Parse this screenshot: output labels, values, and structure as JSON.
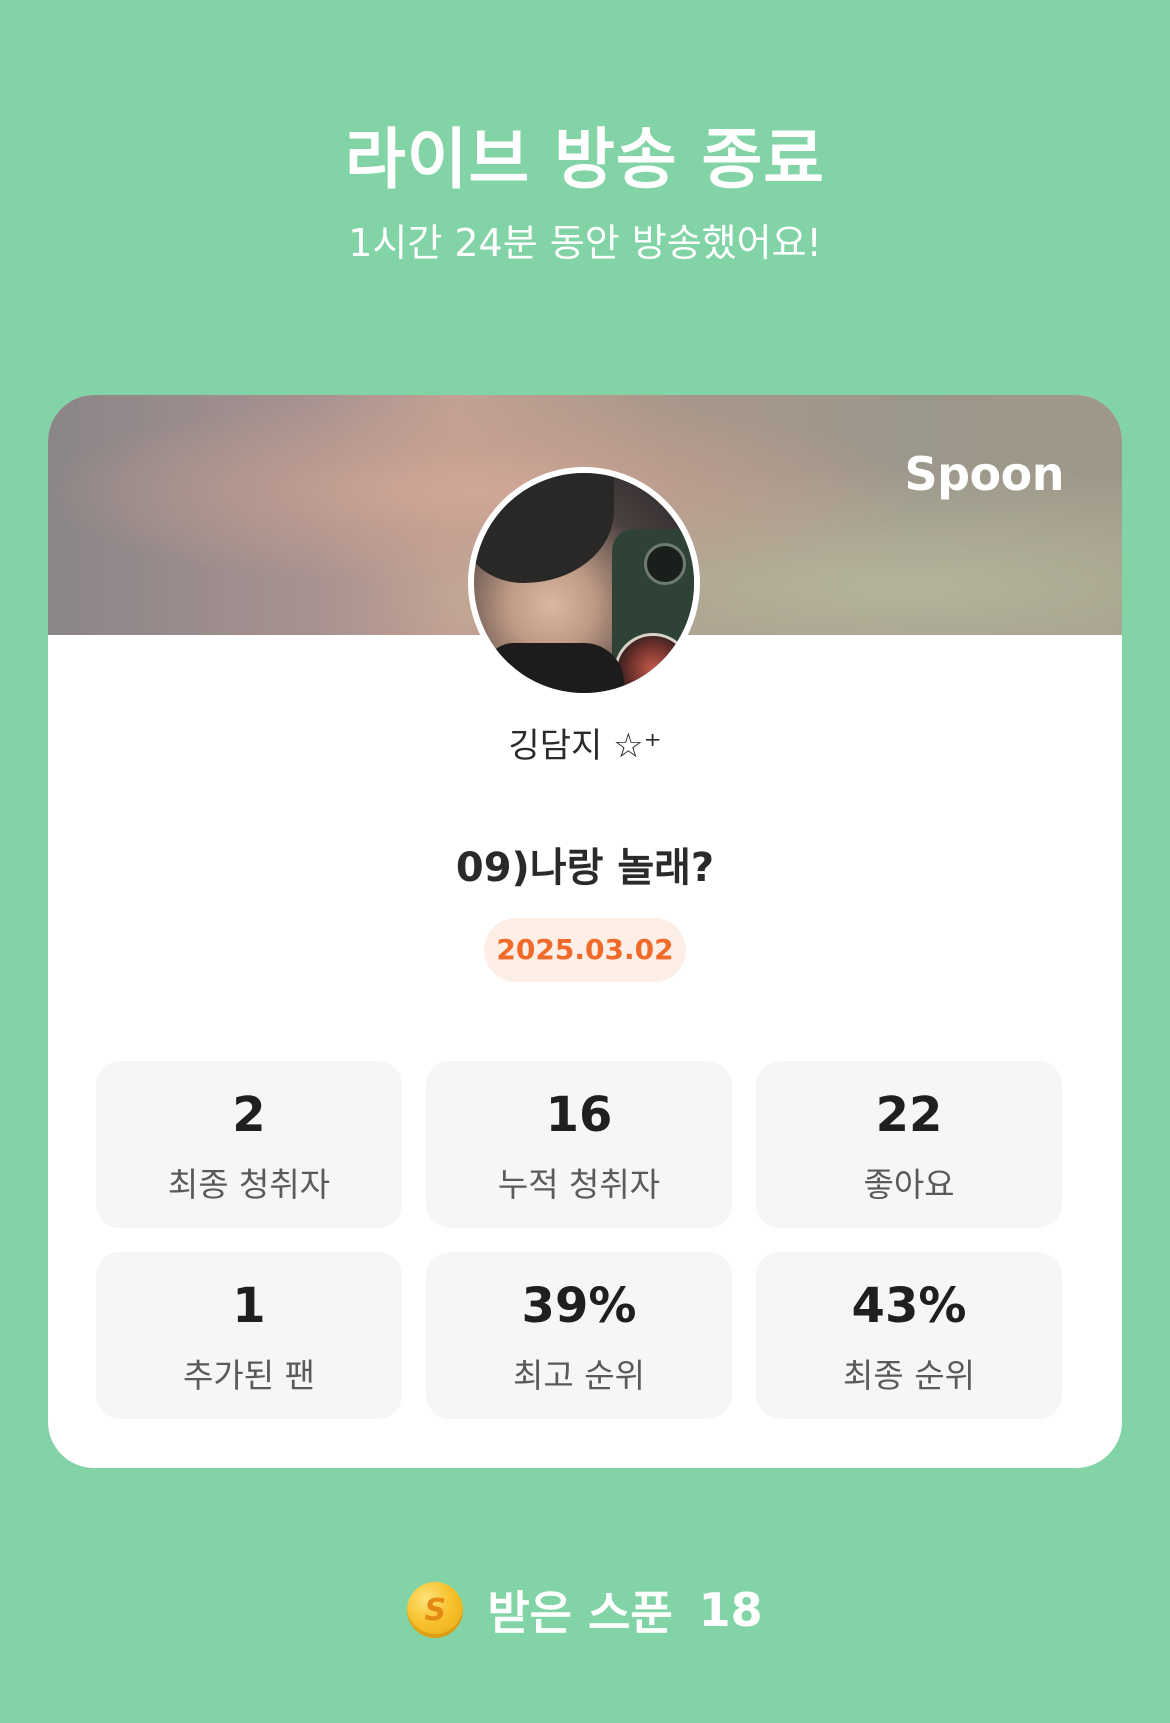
{
  "header": {
    "title": "라이브 방송 종료",
    "subtitle": "1시간 24분 동안 방송했어요!"
  },
  "card": {
    "brand": "Spoon",
    "nickname": "깅담지 ☆⁺",
    "live_title": "09)나랑 놀래?",
    "date": "2025.03.02"
  },
  "stats": [
    {
      "value": "2",
      "label": "최종 청취자"
    },
    {
      "value": "16",
      "label": "누적 청취자"
    },
    {
      "value": "22",
      "label": "좋아요"
    },
    {
      "value": "1",
      "label": "추가된 팬"
    },
    {
      "value": "39%",
      "label": "최고 순위"
    },
    {
      "value": "43%",
      "label": "최종 순위"
    }
  ],
  "footer": {
    "coin_icon": "spoon-coin-icon",
    "coin_glyph": "S",
    "label": "받은 스푼",
    "count": "18"
  },
  "colors": {
    "background": "#82d4a7",
    "date_text": "#f06a2a",
    "date_badge_bg": "#fdeee6",
    "stat_bg": "#f6f6f6"
  }
}
